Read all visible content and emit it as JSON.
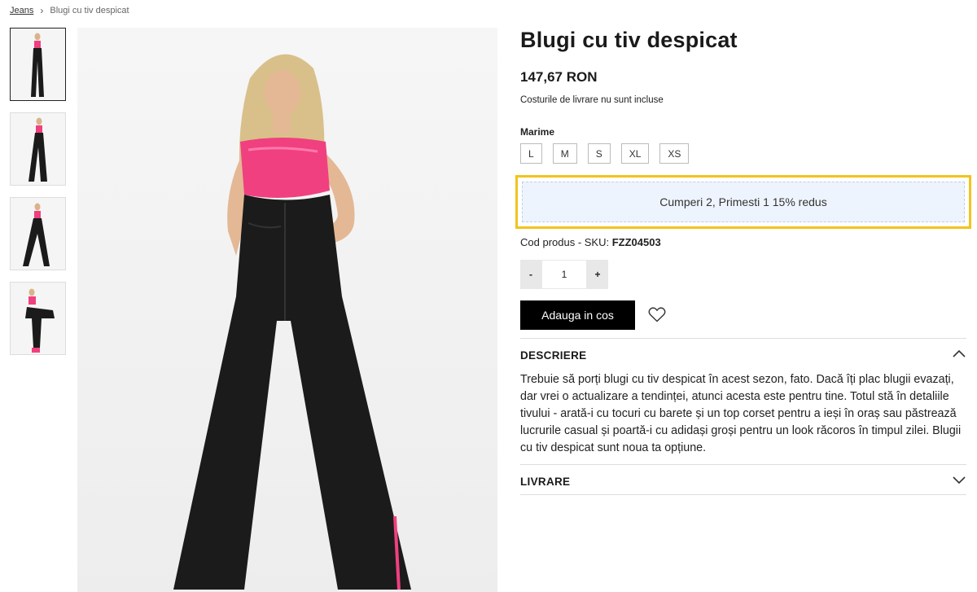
{
  "breadcrumb": {
    "parent": "Jeans",
    "current": "Blugi cu tiv despicat"
  },
  "product": {
    "title": "Blugi cu tiv despicat",
    "price": "147,67 RON",
    "shipping_note": "Costurile de livrare nu sunt incluse",
    "size_label": "Marime",
    "sizes": [
      "L",
      "M",
      "S",
      "XL",
      "XS"
    ],
    "promo": "Cumperi 2, Primesti 1 15% redus",
    "sku_label": "Cod produs - SKU:",
    "sku_value": "FZZ04503",
    "quantity": "1",
    "qty_minus": "-",
    "qty_plus": "+",
    "add_to_cart": "Adauga in cos"
  },
  "sections": {
    "description_title": "DESCRIERE",
    "description_text": "Trebuie să porți blugi cu tiv despicat în acest sezon, fato. Dacă îți plac blugii evazați, dar vrei o actualizare a tendinței, atunci acesta este pentru tine. Totul stă în detaliile tivului - arată-i cu tocuri cu barete și un top corset pentru a ieși în oraș sau păstrează lucrurile casual și poartă-i cu adidași groși pentru un look răcoros în timpul zilei. Blugii cu tiv despicat sunt noua ta opțiune.",
    "shipping_title": "LIVRARE"
  },
  "colors": {
    "accent_highlight": "#f2c31c",
    "promo_bg": "#eef4fd",
    "top_pink": "#f0407f",
    "jeans_black": "#1b1b1b"
  }
}
